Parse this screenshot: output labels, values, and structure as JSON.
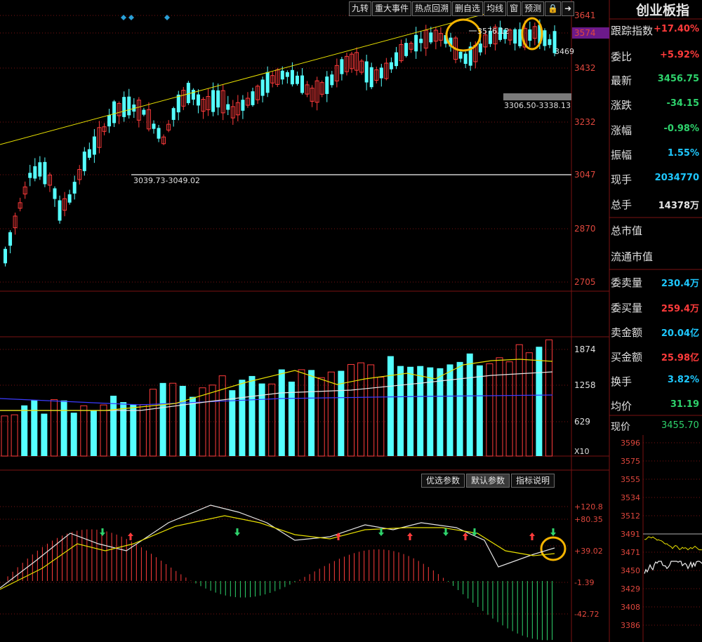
{
  "toolbar": {
    "buttons": [
      "九转",
      "重大事件",
      "热点回溯",
      "删自选",
      "均线",
      "窗",
      "预测",
      "🔒",
      "➜"
    ]
  },
  "indicator_params": {
    "buttons": [
      "优选参数",
      "默认参数",
      "指标说明"
    ],
    "active": 1
  },
  "main_chart": {
    "price_axis_labels": [
      "3641",
      "3574",
      "3432",
      "3232",
      "3047",
      "2870",
      "2705"
    ],
    "highlighted_price": "3574",
    "last_price_tag": "3469",
    "annotation_high": "3576.12",
    "annotation_range_1": "3039.73-3049.02",
    "annotation_range_2": "3306.50-3338.13"
  },
  "volume_chart": {
    "axis_labels": [
      "1874",
      "1258",
      "629"
    ],
    "unit": "X10"
  },
  "macd_chart": {
    "axis_labels": [
      "+120.8",
      "+80.35",
      "+39.02",
      "-1.39",
      "-42.72"
    ]
  },
  "right_panel": {
    "title": "创业板指",
    "rows": [
      {
        "label": "跟踪指数",
        "value": "+17.40%",
        "color": "#ff3b3b"
      },
      {
        "label": "委比",
        "value": "+5.92%",
        "color": "#ff3b3b"
      },
      {
        "label": "最新",
        "value": "3456.75",
        "color": "#2ed36c"
      },
      {
        "label": "涨跌",
        "value": "-34.15",
        "color": "#2ed36c"
      },
      {
        "label": "涨幅",
        "value": "-0.98%",
        "color": "#2ed36c"
      },
      {
        "label": "振幅",
        "value": "1.55%",
        "color": "#1ec8ff"
      },
      {
        "label": "现手",
        "value": "2034770",
        "color": "#1ec8ff"
      },
      {
        "label": "总手",
        "value": "14378万",
        "color": "#e6e6e6"
      },
      {
        "label": "总市值",
        "value": "",
        "color": "#e6e6e6"
      },
      {
        "label": "流通市值",
        "value": "",
        "color": "#e6e6e6"
      },
      {
        "label": "委卖量",
        "value": "230.4万",
        "color": "#1ec8ff"
      },
      {
        "label": "委买量",
        "value": "259.4万",
        "color": "#ff3b3b"
      },
      {
        "label": "卖金额",
        "value": "20.04亿",
        "color": "#1ec8ff"
      },
      {
        "label": "买金额",
        "value": "25.98亿",
        "color": "#ff3b3b"
      },
      {
        "label": "换手",
        "value": "3.82%",
        "color": "#1ec8ff"
      },
      {
        "label": "均价",
        "value": "31.19",
        "color": "#2ed36c"
      }
    ],
    "close_label": "现价",
    "close_value": "3455.70",
    "mini_axis_labels": [
      "3596",
      "3575",
      "3555",
      "3534",
      "3512",
      "3491",
      "3471",
      "3450",
      "3429",
      "3408",
      "3386"
    ]
  },
  "colors": {
    "up": "#ff3b3b",
    "down": "#55ffff",
    "grid": "#7a1212",
    "trendline": "#e8e000",
    "highlight": "#f5b400"
  }
}
